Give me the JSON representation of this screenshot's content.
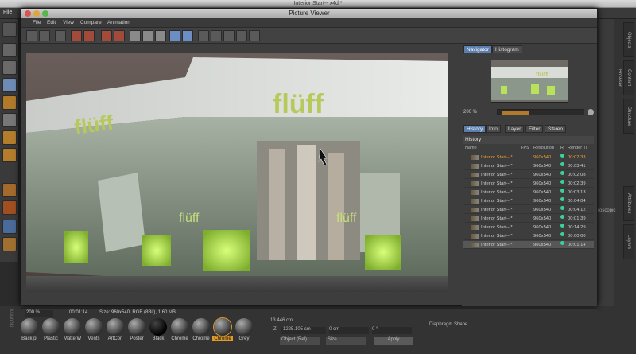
{
  "os": {
    "title": "Interior Start-- x4d *"
  },
  "c4d": {
    "file_menu": "File",
    "bottom_labels": [
      "Back pl",
      "Plastic",
      "Matte W",
      "Vents",
      "ArtCon",
      "Poster",
      "Black",
      "Chrome",
      "Chrome",
      "Chrome",
      "Grey"
    ],
    "coords": {
      "row1": "13.446 cm",
      "row2": "-1225.105 cm",
      "z_label": "Z",
      "row2b": "0 cm",
      "row2c": "0 °",
      "mode": "Object (Rel)",
      "size": "Size",
      "apply": "Apply"
    },
    "right_tabs": [
      "Objects",
      "Content Browser",
      "Structure",
      "Attributes",
      "Layers"
    ],
    "scopic": "roscopic",
    "diaphragm": "Diaphragm Shape"
  },
  "window": {
    "title": "Picture Viewer",
    "menu": [
      "File",
      "Edit",
      "View",
      "Compare",
      "Animation"
    ]
  },
  "navigator": {
    "tabs": [
      "Navigator",
      "Histogram"
    ],
    "zoom": "200 %"
  },
  "history": {
    "tabs": [
      "History",
      "Info",
      "Layer",
      "Filter",
      "Stereo"
    ],
    "heading": "History",
    "columns": [
      "Name",
      "FPS",
      "Resolution",
      "R",
      "Render Ti"
    ],
    "rows": [
      {
        "name": "Interior Start-- *",
        "res": "960x540",
        "time": "00:02:33",
        "active": true
      },
      {
        "name": "Interior Start-- *",
        "res": "960x540",
        "time": "00:03:41",
        "active": false
      },
      {
        "name": "Interior Start-- *",
        "res": "960x540",
        "time": "00:02:08",
        "active": false
      },
      {
        "name": "Interior Start-- *",
        "res": "960x540",
        "time": "00:02:39",
        "active": false
      },
      {
        "name": "Interior Start-- *",
        "res": "960x540",
        "time": "00:03:13",
        "active": false
      },
      {
        "name": "Interior Start-- *",
        "res": "960x540",
        "time": "00:04:04",
        "active": false
      },
      {
        "name": "Interior Start-- *",
        "res": "960x540",
        "time": "00:04:12",
        "active": false
      },
      {
        "name": "Interior Start-- *",
        "res": "960x540",
        "time": "00:01:39",
        "active": false
      },
      {
        "name": "Interior Start-- *",
        "res": "960x540",
        "time": "00:14:29",
        "active": false
      },
      {
        "name": "Interior Start-- *",
        "res": "960x540",
        "time": "00:00:00",
        "active": false
      },
      {
        "name": "Interior Start-- *",
        "res": "960x540",
        "time": "00:01:14",
        "active": false
      }
    ]
  },
  "image": {
    "brand": "flüff",
    "small_brand": "flüff",
    "mid_brand": "flüff"
  },
  "status": {
    "zoom": "200 %",
    "time": "00:01:14",
    "size": "Size: 960x540, RGB (8Bit), 1.60 MB"
  },
  "colors": {
    "accent": "#5d7fae",
    "active_text": "#f0a030",
    "green": "#39d39a"
  }
}
